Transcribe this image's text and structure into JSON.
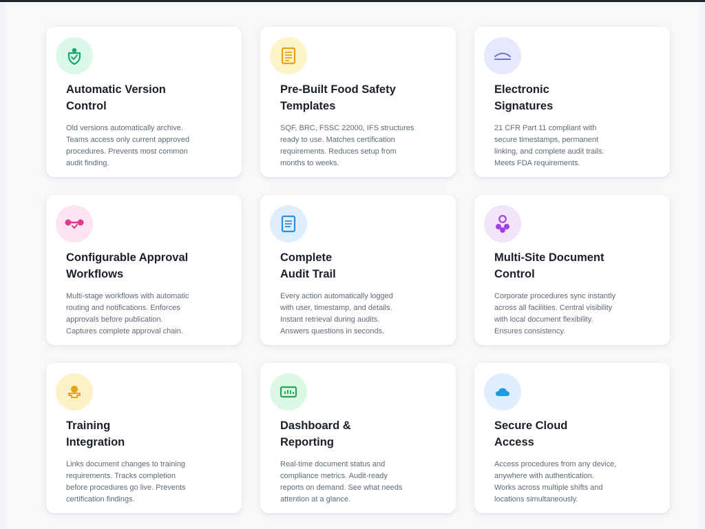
{
  "features": [
    {
      "icon": "shield-check-icon",
      "icon_bg": "#dcf8ea",
      "icon_color": "#12a873",
      "title": [
        "Automatic Version",
        "Control"
      ],
      "desc": [
        "Old versions automatically archive.",
        "Teams access only current approved",
        "procedures. Prevents most common",
        "audit finding."
      ]
    },
    {
      "icon": "document-template-icon",
      "icon_bg": "#fdf3c9",
      "icon_color": "#e5a50f",
      "title": [
        "Pre-Built Food Safety",
        "Templates"
      ],
      "desc": [
        "SQF, BRC, FSSC 22000, IFS structures",
        "ready to use. Matches certification",
        "requirements. Reduces setup from",
        "months to weeks."
      ]
    },
    {
      "icon": "signature-icon",
      "icon_bg": "#e6e8fb",
      "icon_color": "#6b6fd0",
      "title": [
        "Electronic",
        "Signatures"
      ],
      "desc": [
        "21 CFR Part 11 compliant with",
        "secure timestamps, permanent",
        "linking, and complete audit trails.",
        "Meets FDA requirements."
      ]
    },
    {
      "icon": "workflow-icon",
      "icon_bg": "#fde4f1",
      "icon_color": "#e2378f",
      "title": [
        "Configurable Approval",
        "Workflows"
      ],
      "desc": [
        "Multi-stage workflows with automatic",
        "routing and notifications. Enforces",
        "approvals before publication.",
        "Captures complete approval chain."
      ]
    },
    {
      "icon": "audit-log-icon",
      "icon_bg": "#dfeefc",
      "icon_color": "#2e8fd6",
      "title": [
        "Complete",
        "Audit Trail"
      ],
      "desc": [
        "Every action automatically logged",
        "with user, timestamp, and details.",
        "Instant retrieval during audits.",
        "Answers questions in seconds."
      ]
    },
    {
      "icon": "multi-site-icon",
      "icon_bg": "#f2e4fb",
      "icon_color": "#a43fe0",
      "title": [
        "Multi-Site Document",
        "Control"
      ],
      "desc": [
        "Corporate procedures sync instantly",
        "across all facilities. Central visibility",
        "with local document flexibility.",
        "Ensures consistency."
      ]
    },
    {
      "icon": "training-user-icon",
      "icon_bg": "#fdf1c6",
      "icon_color": "#e6a316",
      "title": [
        "Training",
        "Integration"
      ],
      "desc": [
        "Links document changes to training",
        "requirements. Tracks completion",
        "before procedures go live. Prevents",
        "certification findings."
      ]
    },
    {
      "icon": "dashboard-chart-icon",
      "icon_bg": "#ddf7e6",
      "icon_color": "#1faa57",
      "title": [
        "Dashboard &",
        "Reporting"
      ],
      "desc": [
        "Real-time document status and",
        "compliance metrics. Audit-ready",
        "reports on demand. See what needs",
        "attention at a glance."
      ]
    },
    {
      "icon": "cloud-icon",
      "icon_bg": "#dfeefc",
      "icon_color": "#1f9ae0",
      "title": [
        "Secure Cloud",
        "Access"
      ],
      "desc": [
        "Access procedures from any device,",
        "anywhere with authentication.",
        "Works across multiple shifts and",
        "locations simultaneously."
      ]
    }
  ]
}
